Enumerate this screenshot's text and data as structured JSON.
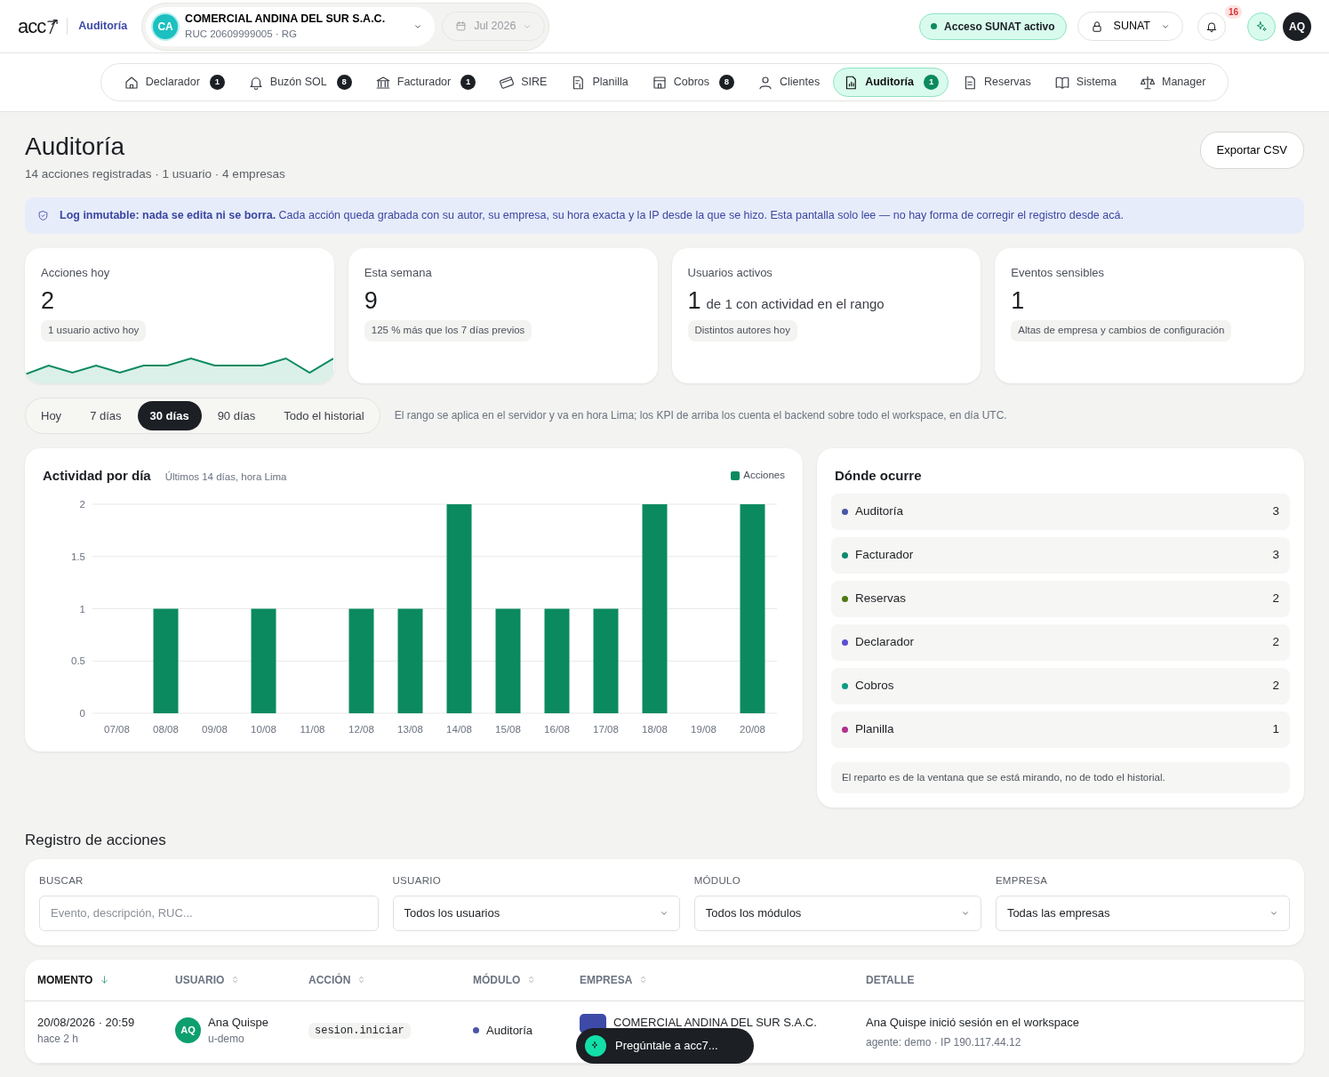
{
  "header": {
    "logo": "acc",
    "section": "Auditoría",
    "company": {
      "initials": "CA",
      "name": "COMERCIAL ANDINA DEL SUR S.A.C.",
      "ruc": "RUC 20609999005 · RG"
    },
    "period": "Jul 2026",
    "sunat_status": "Acceso SUNAT activo",
    "sunat_menu": "SUNAT",
    "notifications": "16",
    "avatar": "AQ"
  },
  "nav": [
    {
      "label": "Declarador",
      "badge": "1",
      "selected": false
    },
    {
      "label": "Buzón SOL",
      "badge": "8",
      "selected": false
    },
    {
      "label": "Facturador",
      "badge": "1",
      "selected": false
    },
    {
      "label": "SIRE",
      "selected": false
    },
    {
      "label": "Planilla",
      "selected": false
    },
    {
      "label": "Cobros",
      "badge": "8",
      "selected": false
    },
    {
      "label": "Clientes",
      "selected": false
    },
    {
      "label": "Auditoría",
      "badge": "1",
      "selected": true
    },
    {
      "label": "Reservas",
      "selected": false
    },
    {
      "label": "Sistema",
      "selected": false
    },
    {
      "label": "Manager",
      "selected": false
    }
  ],
  "page": {
    "title": "Auditoría",
    "subtitle": "14 acciones registradas · 1 usuario · 4 empresas",
    "export": "Exportar CSV"
  },
  "notice": "**Log inmutable: nada se edita ni se borra.** Cada acción queda grabada con su autor, su empresa, su hora exacta y la IP desde la que se hizo. Esta pantalla solo lee — no hay forma de corregir el registro desde acá.",
  "kpis": [
    {
      "kind": "sparkline",
      "label": "Acciones hoy",
      "value": "2",
      "chip": "1 usuario activo hoy"
    },
    {
      "kind": "plain",
      "label": "Esta semana",
      "value": "9",
      "chip": "125 % más que los 7 días previos"
    },
    {
      "kind": "plain",
      "label": "Usuarios activos",
      "value": "1",
      "suffix": "de 1 con actividad en el rango",
      "chip": "Distintos autores hoy"
    },
    {
      "kind": "plain",
      "label": "Eventos sensibles",
      "value": "1",
      "chip": "Altas de empresa y cambios de configuración"
    }
  ],
  "range_tabs": [
    {
      "label": "Hoy",
      "selected": false
    },
    {
      "label": "7 días",
      "selected": false
    },
    {
      "label": "30 días",
      "selected": true
    },
    {
      "label": "90 días",
      "selected": false
    },
    {
      "label": "Todo el historial",
      "selected": false
    }
  ],
  "range_note": "El rango se aplica en el servidor y va en hora Lima; los KPI de arriba los cuenta el backend sobre todo el workspace, en día UTC.",
  "activity": {
    "title": "Actividad por día",
    "subtitle": "Últimos 14 días, hora Lima",
    "chart_data": {
      "type": "bar",
      "categories": [
        "07/08",
        "08/08",
        "09/08",
        "10/08",
        "11/08",
        "12/08",
        "13/08",
        "14/08",
        "15/08",
        "16/08",
        "17/08",
        "18/08",
        "19/08",
        "20/08"
      ],
      "series": [
        {
          "name": "Acciones",
          "color": "#0b8a5f",
          "values": [
            0,
            1,
            0,
            1,
            0,
            1,
            1,
            2,
            1,
            1,
            1,
            2,
            0,
            2
          ]
        }
      ],
      "ylim": [
        0,
        2
      ],
      "yticks": [
        0,
        0.5,
        1,
        1.5,
        2
      ],
      "grid": true
    }
  },
  "where": {
    "title": "Dónde ocurre",
    "items": [
      {
        "label": "Auditoría",
        "count": "3",
        "color": "#4a55a8"
      },
      {
        "label": "Facturador",
        "count": "3",
        "color": "#0d8a6c"
      },
      {
        "label": "Reservas",
        "count": "2",
        "color": "#4d7a12"
      },
      {
        "label": "Declarador",
        "count": "2",
        "color": "#5b4fd0"
      },
      {
        "label": "Cobros",
        "count": "2",
        "color": "#0e9a86"
      },
      {
        "label": "Planilla",
        "count": "1",
        "color": "#b0308f"
      }
    ],
    "note": "El reparto es de la ventana que se está mirando, no de todo el historial."
  },
  "log": {
    "title": "Registro de acciones",
    "filters": [
      {
        "kind": "text",
        "label": "BUSCAR",
        "placeholder": "Evento, descripción, RUC..."
      },
      {
        "kind": "select",
        "label": "USUARIO",
        "value": "Todos los usuarios"
      },
      {
        "kind": "select",
        "label": "MÓDULO",
        "value": "Todos los módulos"
      },
      {
        "kind": "select",
        "label": "EMPRESA",
        "value": "Todas las empresas"
      }
    ],
    "columns": [
      {
        "label": "MOMENTO",
        "sorted": true
      },
      {
        "label": "USUARIO",
        "sorted": false
      },
      {
        "label": "ACCIÓN",
        "sorted": false
      },
      {
        "label": "MÓDULO",
        "sorted": false
      },
      {
        "label": "EMPRESA",
        "sorted": false
      },
      {
        "label": "DETALLE"
      }
    ],
    "rows": [
      {
        "time": "20/08/2026 · 20:59",
        "ago": "hace 2 h",
        "user": {
          "initials": "AQ",
          "name": "Ana Quispe",
          "handle": "u-demo"
        },
        "action": "sesion.iniciar",
        "module": {
          "label": "Auditoría",
          "color": "#4a55a8"
        },
        "company": "COMERCIAL ANDINA DEL SUR S.A.C.",
        "detail": "Ana Quispe inició sesión en el workspace",
        "detail_meta": "agente: demo · IP 190.117.44.12"
      }
    ]
  },
  "assistant": "Pregúntale a acc7..."
}
